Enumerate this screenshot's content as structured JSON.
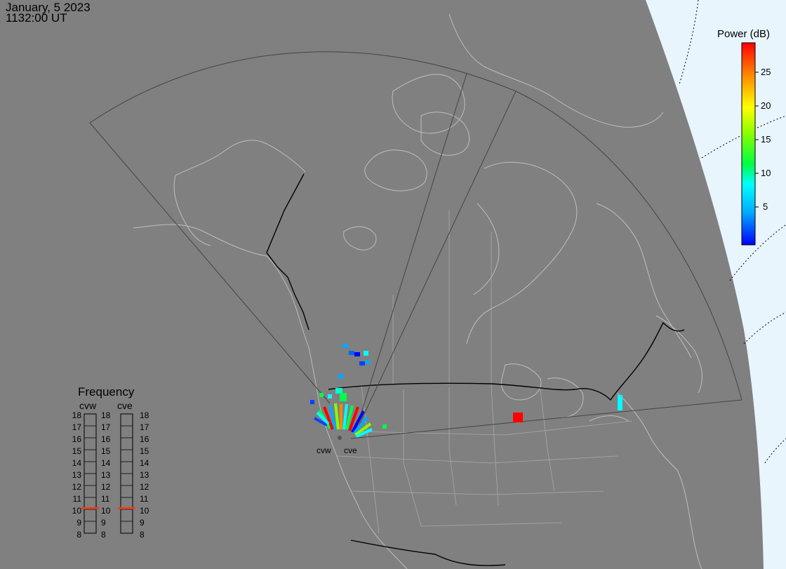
{
  "header": {
    "date": "January, 5 2023",
    "time": "1132:00 UT"
  },
  "colorbar": {
    "title": "Power (dB)",
    "ticks": [
      "25",
      "20",
      "15",
      "10",
      "5"
    ],
    "colors": [
      "#0000ff",
      "#00aaff",
      "#00ffff",
      "#00ff44",
      "#88ff00",
      "#ffff00",
      "#ff8800",
      "#ff0000"
    ]
  },
  "frequency": {
    "title": "Frequency",
    "radars": [
      {
        "name": "cvw",
        "selected_mhz": 10.6
      },
      {
        "name": "cve",
        "selected_mhz": 10.6
      }
    ],
    "labels": [
      "18",
      "17",
      "16",
      "15",
      "14",
      "13",
      "12",
      "11",
      "10",
      "9",
      "8"
    ]
  },
  "radars": [
    "cvw",
    "cve"
  ],
  "map_colors": {
    "land": "#808080",
    "space": "#e8f5fc",
    "coast": "#bdbdbd",
    "border": "#000000"
  }
}
